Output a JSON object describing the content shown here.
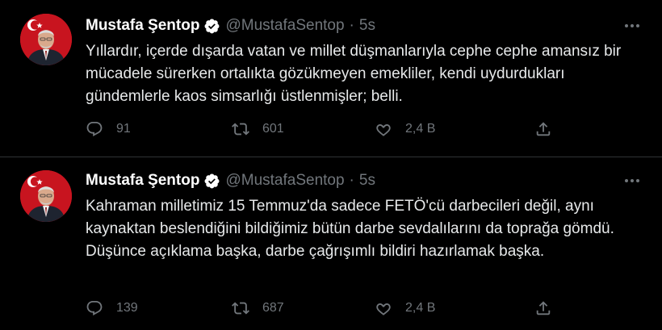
{
  "tweets": [
    {
      "author_name": "Mustafa Şentop",
      "handle": "@MustafaSentop",
      "separator": "·",
      "time": "5s",
      "text": "Yıllardır, içerde dışarda vatan ve millet düşmanlarıyla cephe cephe amansız bir mücadele sürerken ortalıkta gözükmeyen emekliler, kendi uydurdukları gündemlerle kaos simsarlığı üstlenmişler; belli.",
      "replies": "91",
      "retweets": "601",
      "likes": "2,4 B"
    },
    {
      "author_name": "Mustafa Şentop",
      "handle": "@MustafaSentop",
      "separator": "·",
      "time": "5s",
      "text": "Kahraman milletimiz 15 Temmuz'da sadece FETÖ'cü darbecileri değil, aynı kaynaktan beslendiğini bildiğimiz bütün darbe sevdalılarını da toprağa gömdü. Düşünce açıklama başka, darbe çağrışımlı bildiri hazırlamak başka.",
      "replies": "139",
      "retweets": "687",
      "likes": "2,4 B"
    }
  ],
  "icons": {
    "verified": "verified-badge-icon",
    "more": "more-options-icon",
    "reply": "reply-icon",
    "retweet": "retweet-icon",
    "like": "heart-icon",
    "share": "share-icon"
  },
  "colors": {
    "background": "#000000",
    "text": "#e7e9ea",
    "secondary": "#71767b",
    "divider": "#2f3336",
    "verified": "#1d9bf0",
    "flag_red": "#c8141f"
  }
}
